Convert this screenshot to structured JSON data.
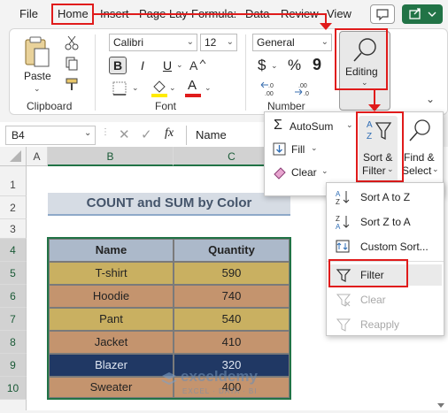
{
  "menu": {
    "tabs": [
      "File",
      "Home",
      "Insert",
      "Page Lay",
      "Formula:",
      "Data",
      "Review",
      "View"
    ]
  },
  "ribbon": {
    "clipboard_label": "Clipboard",
    "paste_label": "Paste",
    "font_label": "Font",
    "font_name": "Calibri",
    "font_size": "12",
    "bold": "B",
    "italic": "I",
    "underline": "U",
    "font_color_letter": "A",
    "number_label": "Number",
    "number_format": "General",
    "currency_symbol": "$",
    "percent_symbol": "%",
    "comma_symbol": "9",
    "editing_label": "Editing"
  },
  "editing_panel": {
    "autosum": "AutoSum",
    "fill": "Fill",
    "clear": "Clear",
    "sort_filter_line1": "Sort &",
    "sort_filter_line2": "Filter",
    "find_select_line1": "Find &",
    "find_select_line2": "Select"
  },
  "sort_menu": {
    "sort_az": "Sort A to Z",
    "sort_za": "Sort Z to A",
    "custom_sort": "Custom Sort...",
    "filter": "Filter",
    "clear": "Clear",
    "reapply": "Reapply"
  },
  "formula_bar": {
    "name_box": "B4",
    "cancel": "✕",
    "enter": "✓",
    "fx": "fx",
    "content": "Name"
  },
  "sheet": {
    "columns": [
      "A",
      "B",
      "C"
    ],
    "rows": [
      "1",
      "2",
      "3",
      "4",
      "5",
      "6",
      "7",
      "8",
      "9",
      "10"
    ],
    "title": "COUNT and SUM by Color",
    "headers": [
      "Name",
      "Quantity"
    ],
    "data": [
      {
        "name": "T-shirt",
        "qty": "590"
      },
      {
        "name": "Hoodie",
        "qty": "740"
      },
      {
        "name": "Pant",
        "qty": "540"
      },
      {
        "name": "Jacket",
        "qty": "410"
      },
      {
        "name": "Blazer",
        "qty": "320"
      },
      {
        "name": "Sweater",
        "qty": "400"
      }
    ]
  },
  "watermark": {
    "brand": "exceldemy",
    "tagline": "EXCEL · DATA · BI"
  },
  "colors": {
    "accent_red": "#e01b1b",
    "excel_green": "#217346",
    "header_fill": "#acb9ca",
    "title_fill": "#d6dce4",
    "gold": "#c9b061",
    "tan": "#c4946e",
    "navy": "#203864"
  }
}
